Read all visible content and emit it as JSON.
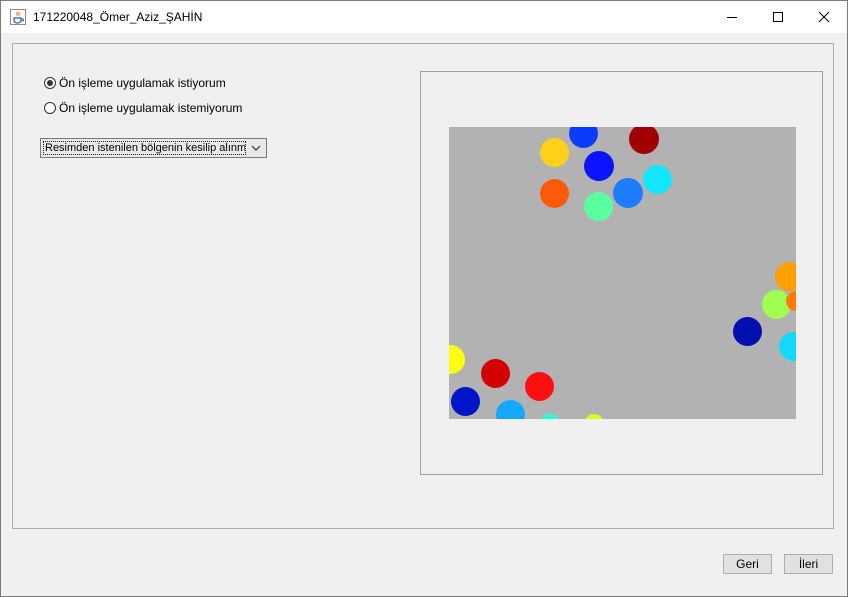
{
  "window": {
    "title": "171220048_Ömer_Aziz_ŞAHİN",
    "icon": "java-cup-icon",
    "controls": [
      "minimize-icon",
      "maximize-icon",
      "close-icon"
    ]
  },
  "options": {
    "apply_preprocessing": "Ön işleme uygulamak istiyorum",
    "no_preprocessing": "Ön işleme uygulamak istemiyorum",
    "selected": "apply_preprocessing"
  },
  "combo": {
    "value": "Resimden istenilen bölgenin kesilip alınması",
    "icon": "chevron-down-icon"
  },
  "image": {
    "background": "#b2b2b2",
    "dot_colors": [
      "#ffd11a",
      "#0a3cff",
      "#a00000",
      "#0a14ff",
      "#ff5a0a",
      "#1e7cff",
      "#14e6ff",
      "#5affa0",
      "#ffa000",
      "#a0ff50",
      "#ff7a0a",
      "#0010b0",
      "#14d8ff",
      "#ffff14",
      "#d40000",
      "#ff1010",
      "#0014c8",
      "#14a8ff",
      "#24ffd8",
      "#d8ff14"
    ]
  },
  "buttons": {
    "back": "Geri",
    "next": "İleri"
  }
}
